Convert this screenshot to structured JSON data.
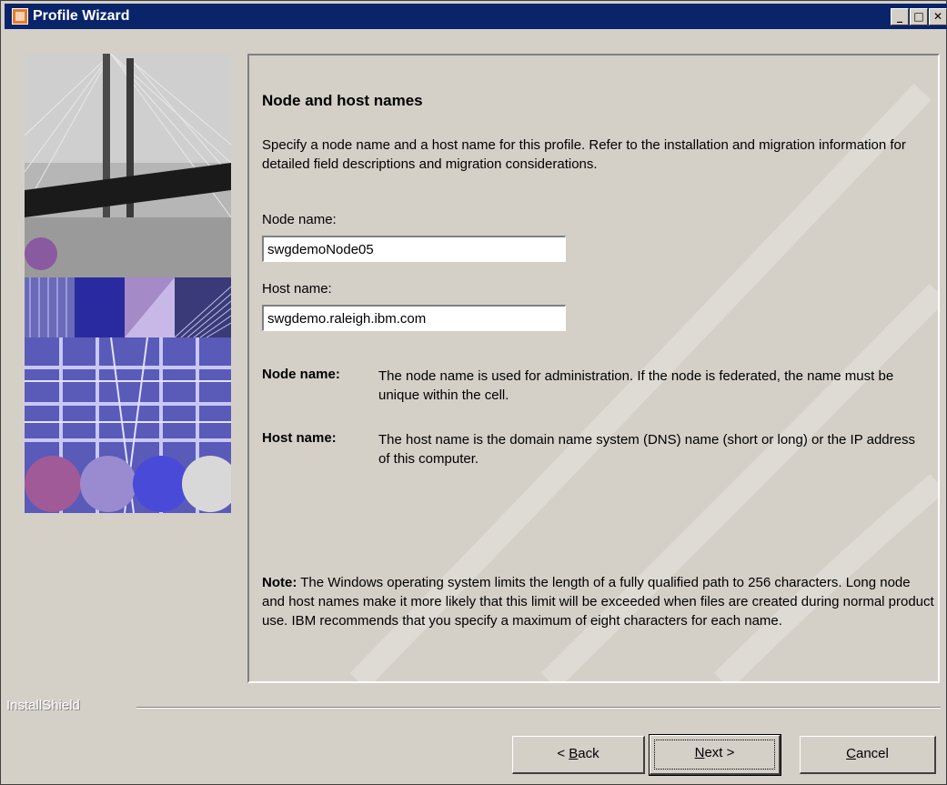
{
  "window": {
    "title": "Profile Wizard"
  },
  "page": {
    "heading": "Node and host names",
    "intro": "Specify a node name and a host name for this profile. Refer to the installation and migration information for detailed field descriptions and migration considerations."
  },
  "fields": {
    "node_name": {
      "label": "Node name:",
      "value": "swgdemoNode05"
    },
    "host_name": {
      "label": "Host name:",
      "value": "swgdemo.raleigh.ibm.com"
    }
  },
  "descriptions": {
    "node_term": "Node name:",
    "node_text": "The node name is used for administration. If the node is federated, the name must be unique within the cell.",
    "host_term": "Host name:",
    "host_text": "The host name is the domain name system (DNS) name (short or long) or the IP address of this computer."
  },
  "note": {
    "label": "Note:",
    "text": " The Windows operating system limits the length of a fully qualified path to 256 characters. Long node and host names make it more likely that this limit will be exceeded when files are created during normal product use. IBM recommends that you specify a maximum of eight characters for each name."
  },
  "footer": {
    "brand": "InstallShield",
    "back_prefix": "< ",
    "back_mnemonic": "B",
    "back_rest": "ack",
    "next_mnemonic": "N",
    "next_rest": "ext >",
    "cancel_mnemonic": "C",
    "cancel_rest": "ancel"
  },
  "icons": [
    "app-icon",
    "minimize-icon",
    "maximize-icon",
    "close-icon"
  ],
  "colors": {
    "titlebar": "#0a246a",
    "face": "#d4d0c8"
  }
}
